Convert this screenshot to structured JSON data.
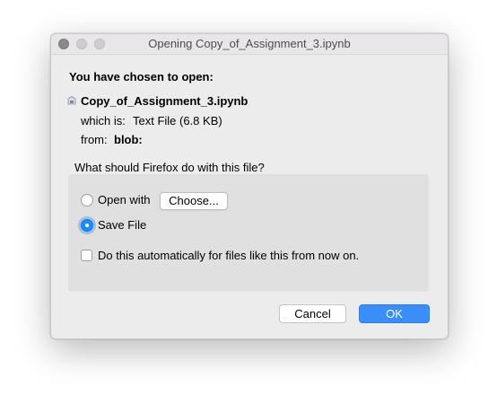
{
  "window": {
    "title": "Opening Copy_of_Assignment_3.ipynb"
  },
  "dialog": {
    "heading": "You have chosen to open:",
    "file_name": "Copy_of_Assignment_3.ipynb",
    "file_icon": "document-icon",
    "which_is_label": "which is:",
    "which_is_value": "Text File (6.8 KB)",
    "from_label": "from:",
    "from_value": "blob:",
    "question": "What should Firefox do with this file?"
  },
  "options": {
    "open_with_label": "Open with",
    "open_with_selected": false,
    "choose_button_label": "Choose...",
    "save_file_label": "Save File",
    "save_file_selected": true,
    "auto_label": "Do this automatically for files like this from now on.",
    "auto_checked": false
  },
  "buttons": {
    "cancel_label": "Cancel",
    "ok_label": "OK"
  },
  "colors": {
    "accent": "#3b8df7",
    "window_bg": "#ececec",
    "panel_bg": "#e0e0e0"
  }
}
